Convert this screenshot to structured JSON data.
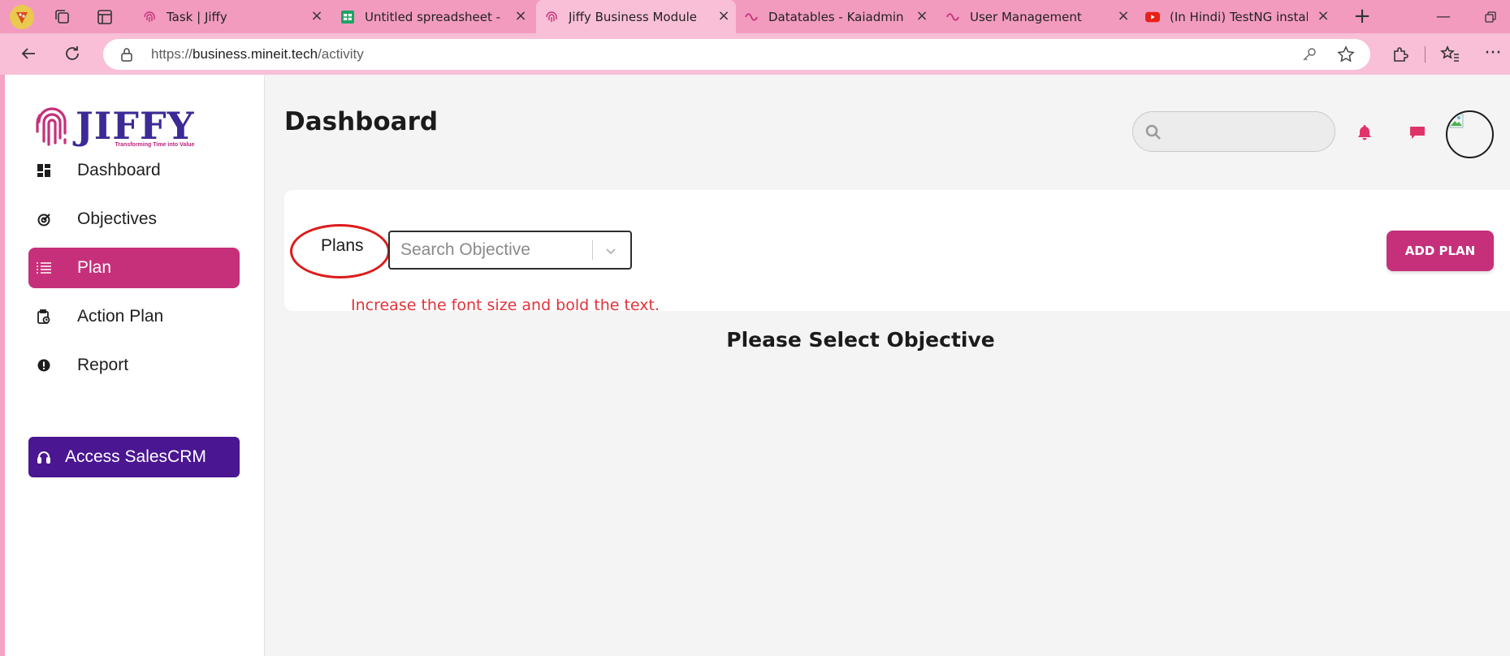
{
  "browser": {
    "tabs": [
      {
        "label": "Task | Jiffy",
        "icon": "jiffy-fingerprint-icon"
      },
      {
        "label": "Untitled spreadsheet - Go",
        "icon": "google-sheets-icon"
      },
      {
        "label": "Jiffy Business Module",
        "icon": "jiffy-fingerprint-icon",
        "active": true
      },
      {
        "label": "Datatables - Kaiadmin Boo",
        "icon": "kaiadmin-icon"
      },
      {
        "label": "User Management",
        "icon": "kaiadmin-icon"
      },
      {
        "label": "(In Hindi) TestNG installati",
        "icon": "youtube-icon"
      }
    ],
    "url_prefix": "https://",
    "url_host": "business.mineit.tech",
    "url_path": "/activity"
  },
  "sidebar": {
    "logo": {
      "title": "JIFFY",
      "tagline": "Transforming Time into Value"
    },
    "items": [
      {
        "label": "Dashboard",
        "icon": "grid-icon"
      },
      {
        "label": "Objectives",
        "icon": "target-icon"
      },
      {
        "label": "Plan",
        "icon": "list-icon",
        "active": true
      },
      {
        "label": "Action Plan",
        "icon": "clipboard-icon"
      },
      {
        "label": "Report",
        "icon": "alert-icon"
      }
    ],
    "crm_button": {
      "label": "Access SalesCRM",
      "icon": "headset-icon"
    }
  },
  "header": {
    "title": "Dashboard",
    "search_placeholder": ""
  },
  "content": {
    "plans_label": "Plans",
    "objective_placeholder": "Search Objective",
    "add_plan_label": "ADD PLAN",
    "annotation": "Increase the font size and bold the text.",
    "empty_message": "Please Select Objective"
  },
  "colors": {
    "brand_pink": "#c6307a",
    "crm_purple": "#4a1691",
    "annotation_red": "#e0333a",
    "browser_chrome": "#f29bbf"
  }
}
